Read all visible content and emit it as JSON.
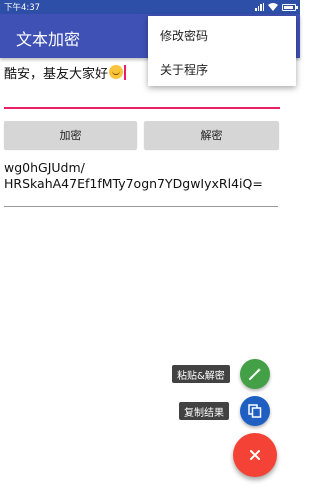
{
  "status_bar": {
    "time": "下午4:37"
  },
  "app_bar": {
    "title": "文本加密"
  },
  "menu": {
    "items": [
      "修改密码",
      "关于程序"
    ]
  },
  "input": {
    "text": "酷安，基友大家好"
  },
  "buttons": {
    "encrypt": "加密",
    "decrypt": "解密"
  },
  "result": {
    "text": "wg0hGJUdm/\nHRSkahA47Ef1fMTy7ogn7YDgwIyxRl4iQ="
  },
  "fab": {
    "paste_label": "粘贴&解密",
    "copy_label": "复制结果"
  },
  "colors": {
    "primary": "#3f51b5",
    "accent": "#e91e63",
    "fab_main": "#f44336",
    "fab_paste": "#43a047",
    "fab_copy": "#1e5fc1"
  }
}
